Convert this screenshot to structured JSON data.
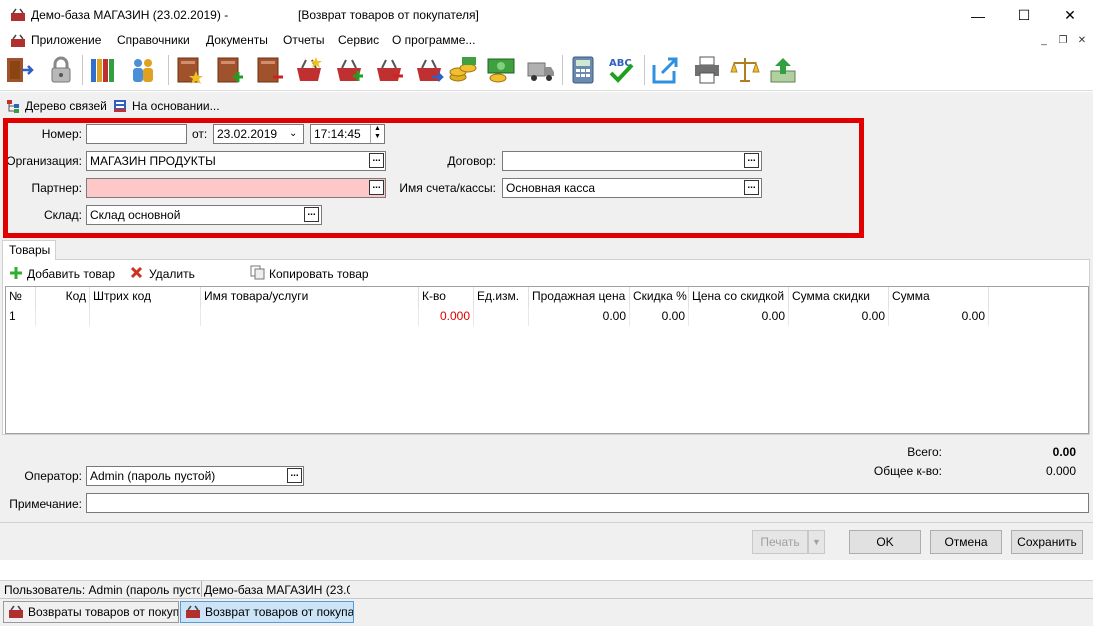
{
  "window": {
    "title": "Демо-база МАГАЗИН (23.02.2019) -",
    "document_title": "[Возврат товаров от покупателя]",
    "minimize_glyph": "—",
    "maximize_glyph": "☐",
    "close_glyph": "✕"
  },
  "menu": {
    "items": [
      "Приложение",
      "Справочники",
      "Документы",
      "Отчеты",
      "Сервис",
      "О программе..."
    ]
  },
  "secondary_toolbar": {
    "links_tree": "Дерево связей",
    "based_on": "На основании..."
  },
  "form": {
    "number_label": "Номер:",
    "number_value": "",
    "from_label": "от:",
    "date_value": "23.02.2019",
    "time_value": "17:14:45",
    "org_label": "Организация:",
    "org_value": "МАГАЗИН ПРОДУКТЫ",
    "contract_label": "Договор:",
    "contract_value": "",
    "partner_label": "Партнер:",
    "partner_value": "",
    "account_label": "Имя счета/кассы:",
    "account_value": "Основная касса",
    "warehouse_label": "Склад:",
    "warehouse_value": "Склад основной",
    "dots": "..."
  },
  "tabs": {
    "goods": "Товары"
  },
  "goods_toolbar": {
    "add": "Добавить товар",
    "delete": "Удалить",
    "copy": "Копировать товар"
  },
  "grid": {
    "headers": [
      "№",
      "Код",
      "Штрих код",
      "Имя товара/услуги",
      "К-во",
      "Ед.изм.",
      "Продажная цена",
      "Скидка %",
      "Цена со скидкой",
      "Сумма скидки",
      "Сумма"
    ],
    "rows": [
      [
        "1",
        "",
        "",
        "",
        "0.000",
        "",
        "0.00",
        "0.00",
        "0.00",
        "0.00",
        "0.00"
      ]
    ]
  },
  "totals": {
    "total_label": "Всего:",
    "total_value": "0.00",
    "qty_label": "Общее к-во:",
    "qty_value": "0.000"
  },
  "footer": {
    "operator_label": "Оператор:",
    "operator_value": "Admin (пароль пустой)",
    "note_label": "Примечание:",
    "note_value": ""
  },
  "buttons": {
    "print": "Печать",
    "ok": "OK",
    "cancel": "Отмена",
    "save": "Сохранить"
  },
  "status": {
    "user": "Пользователь: Admin (пароль пусто",
    "db": "Демо-база МАГАЗИН (23.0"
  },
  "taskbar": {
    "tab1": "Возвраты товаров от покупат",
    "tab2": "Возврат товаров от покупате"
  },
  "colors": {
    "highlight": "#e00000",
    "required_field": "#ffc8c8",
    "qty_red": "#e00000"
  }
}
